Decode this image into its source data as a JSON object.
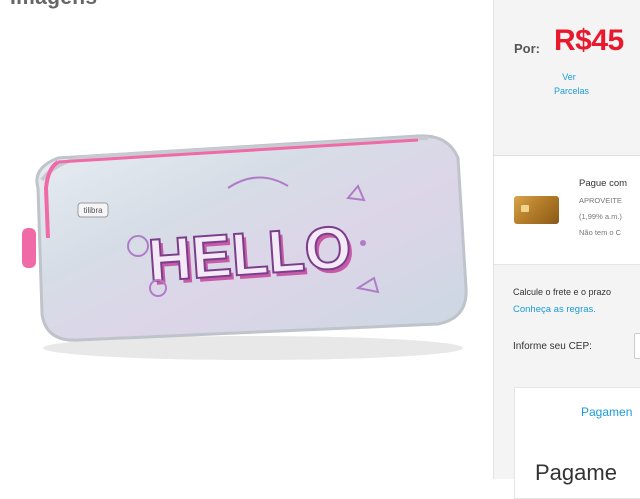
{
  "gallery": {
    "title": "Imagens"
  },
  "product": {
    "image_alt": "Estojo Tilibra Hello"
  },
  "price": {
    "por_label": "Por:",
    "value": "R$45",
    "parcelas_line1": "Ver",
    "parcelas_line2": "Parcelas"
  },
  "card": {
    "title": "Pague com",
    "line1": "APROVEITE",
    "line2": "(1,99% a.m.)",
    "line3": "Não tem o C"
  },
  "shipping": {
    "calc_text": "Calcule o frete e o prazo",
    "rules_link": "Conheça as regras.",
    "cep_label": "Informe seu CEP:"
  },
  "payment": {
    "link": "Pagamen",
    "heading": "Pagame"
  },
  "colors": {
    "price": "#e8192c",
    "link": "#1a9bd7",
    "zipper": "#f06aa8"
  }
}
